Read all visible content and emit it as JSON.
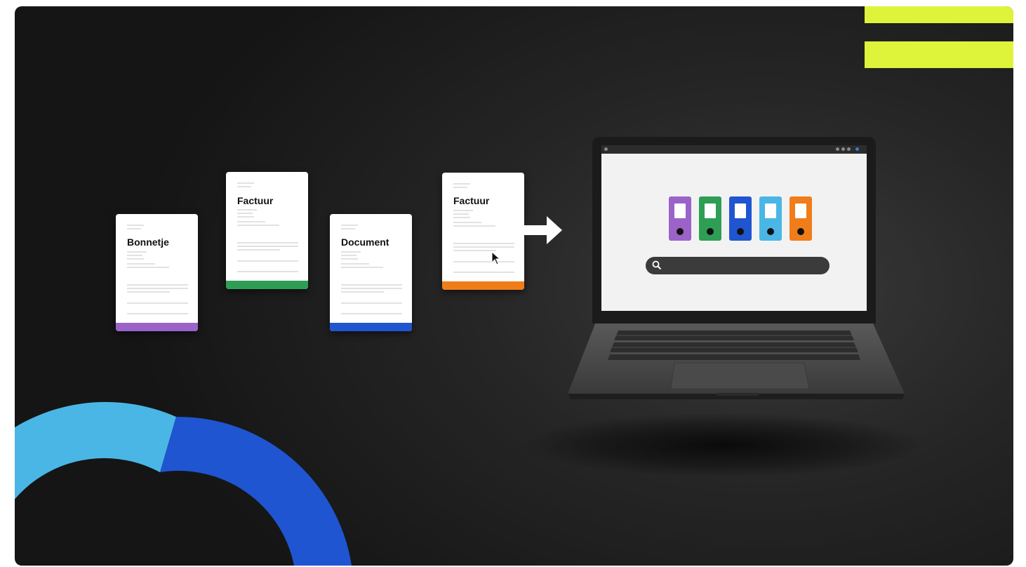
{
  "documents": [
    {
      "title": "Bonnetje",
      "stripe_color": "#9b63c8"
    },
    {
      "title": "Factuur",
      "stripe_color": "#2e9e55"
    },
    {
      "title": "Document",
      "stripe_color": "#1f55d0"
    },
    {
      "title": "Factuur",
      "stripe_color": "#f07d1a"
    }
  ],
  "binders": [
    {
      "color": "#9b63c8"
    },
    {
      "color": "#2e9e55"
    },
    {
      "color": "#1f55d0"
    },
    {
      "color": "#4ab6e6"
    },
    {
      "color": "#f07d1a"
    }
  ],
  "accent_colors": {
    "yellow": "#ddf43a",
    "ring_light": "#4ab6e6",
    "ring_dark": "#1f55d0"
  },
  "icons": [
    "arrow-right-icon",
    "cursor-icon",
    "search-icon",
    "binder-icon"
  ]
}
